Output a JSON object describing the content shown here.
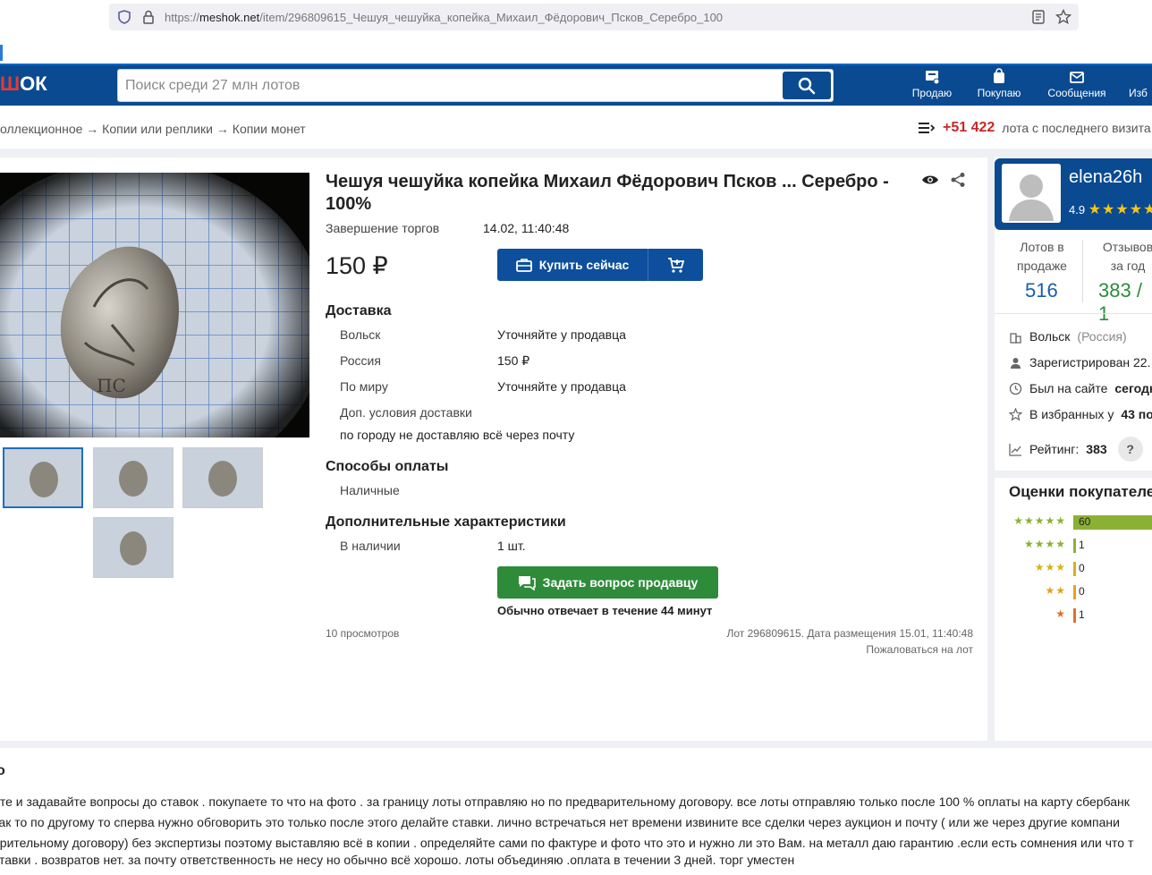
{
  "browser": {
    "url_prefix": "https://",
    "url_domain": "meshok.net",
    "url_path": "/item/296809615_Чешуя_чешуйка_копейка_Михаил_Фёдорович_Псков_Серебро_100"
  },
  "header": {
    "logo_red": "Ш",
    "logo_rest": "ОК",
    "search_placeholder": "Поиск среди 27 млн лотов",
    "nav": [
      {
        "label": "Продаю",
        "icon": "sell-icon"
      },
      {
        "label": "Покупаю",
        "icon": "shopping-bag-icon"
      },
      {
        "label": "Сообщения",
        "icon": "mail-icon"
      },
      {
        "label": "Изб",
        "icon": "favorites-icon"
      }
    ]
  },
  "breadcrumb": "оллекционное → Копии или реплики → Копии монет",
  "new_lots": {
    "count": "+51 422",
    "text": "лота с последнего визита"
  },
  "lot": {
    "title": "Чешуя чешуйка копейка Михаил Фёдорович Псков ... Серебро - 100%",
    "end_label": "Завершение торгов",
    "end_value": "14.02, 11:40:48",
    "price": "150 ₽",
    "buy_label": "Купить сейчас",
    "delivery_title": "Доставка",
    "delivery": [
      {
        "label": "Вольск",
        "value": "Уточняйте у продавца"
      },
      {
        "label": "Россия",
        "value": "150 ₽"
      },
      {
        "label": "По миру",
        "value": "Уточняйте у продавца"
      }
    ],
    "extra_delivery_label": "Доп. условия доставки",
    "extra_delivery_value": "по городу не доставляю всё через почту",
    "payment_title": "Способы оплаты",
    "payment_value": "Наличные",
    "chars_title": "Дополнительные характеристики",
    "stock_label": "В наличии",
    "stock_value": "1 шт.",
    "ask_label": "Задать вопрос продавцу",
    "reply_time": "Обычно отвечает в течение 44 минут",
    "views": "10 просмотров",
    "lot_info": "Лот 296809615. Дата размещения 15.01, 11:40:48",
    "report": "Пожаловаться на лот"
  },
  "seller": {
    "name": "elena26h",
    "rating": "4.9",
    "stars": "★★★★★",
    "lots_label": "Лотов в продаже",
    "lots_value": "516",
    "reviews_label": "Отзывов за год",
    "reviews_value": "383 / 1",
    "city": "Вольск",
    "country": "(Россия)",
    "registered": "Зарегистрирован 22.",
    "last_seen_label": "Был на сайте",
    "last_seen_value": "сегодн",
    "favorites_label": "В избранных у",
    "favorites_value": "43 пол",
    "rating_label": "Рейтинг:",
    "rating_value": "383",
    "help": "?"
  },
  "buyer_ratings": {
    "title": "Оценки покупателе",
    "rows": [
      {
        "stars": "★★★★★",
        "count": "60",
        "fraction": 0.97,
        "color": "#8bb134"
      },
      {
        "stars": "★★★★",
        "count": "1",
        "fraction": 0.02,
        "color": "#8bb134"
      },
      {
        "stars": "★★★",
        "count": "0",
        "fraction": 0.01,
        "color": "#d4b21a"
      },
      {
        "stars": "★★",
        "count": "0",
        "fraction": 0.01,
        "color": "#e5a21a"
      },
      {
        "stars": "★",
        "count": "1",
        "fraction": 0.02,
        "color": "#e0702a"
      }
    ]
  },
  "description": {
    "title": "о",
    "lines": [
      "ите и задавайте вопросы до ставок . покупаете то что на фото . за границу лоты отправляю но по предварительному договору. все лоты отправляю только после 100 % оплаты на карту сбербанк",
      " как то по другому то сперва нужно обговорить это только после этого делайте ставки. лично встречаться нет времени извините все сделки через аукцион и почту ( или же через другие компани",
      "арительному договору) без экспертизы поэтому выставляю всё в копии . определяйте сами по фактуре и фото что это и нужно ли это Вам. на металл даю гарантию .если есть сомнения или что т",
      " ставки . возвратов нет. за почту ответственность не несу но обычно всё хорошо. лоты объединяю .оплата в течении 3 дней. торг уместен"
    ]
  }
}
